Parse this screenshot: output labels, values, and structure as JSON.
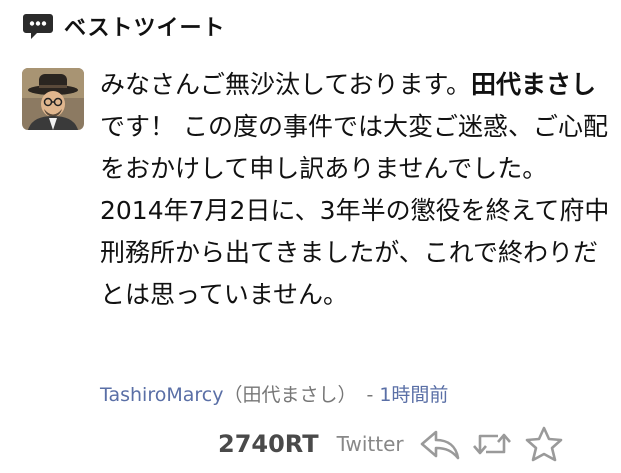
{
  "header": {
    "title": "ベストツイート",
    "icon": "speech-bubble-icon"
  },
  "tweet": {
    "avatar": "user-avatar",
    "text_1": "みなさんご無沙汰しております。",
    "text_bold": "田代まさし",
    "text_2": "です！ この度の事件では大変ご迷惑、ご心配をおかけして申し訳ありませんでした。 2014年7月2日に、3年半の懲役を終えて府中刑務所から出てきましたが、これで終わりだとは思っていません。",
    "username": "TashiroMarcy",
    "fullname": "（田代まさし）",
    "separator": "-",
    "time": "1時間前"
  },
  "footer": {
    "retweet_count": "2740RT",
    "source": "Twitter",
    "reply_icon": "reply-icon",
    "retweet_icon": "retweet-icon",
    "favorite_icon": "star-icon"
  }
}
